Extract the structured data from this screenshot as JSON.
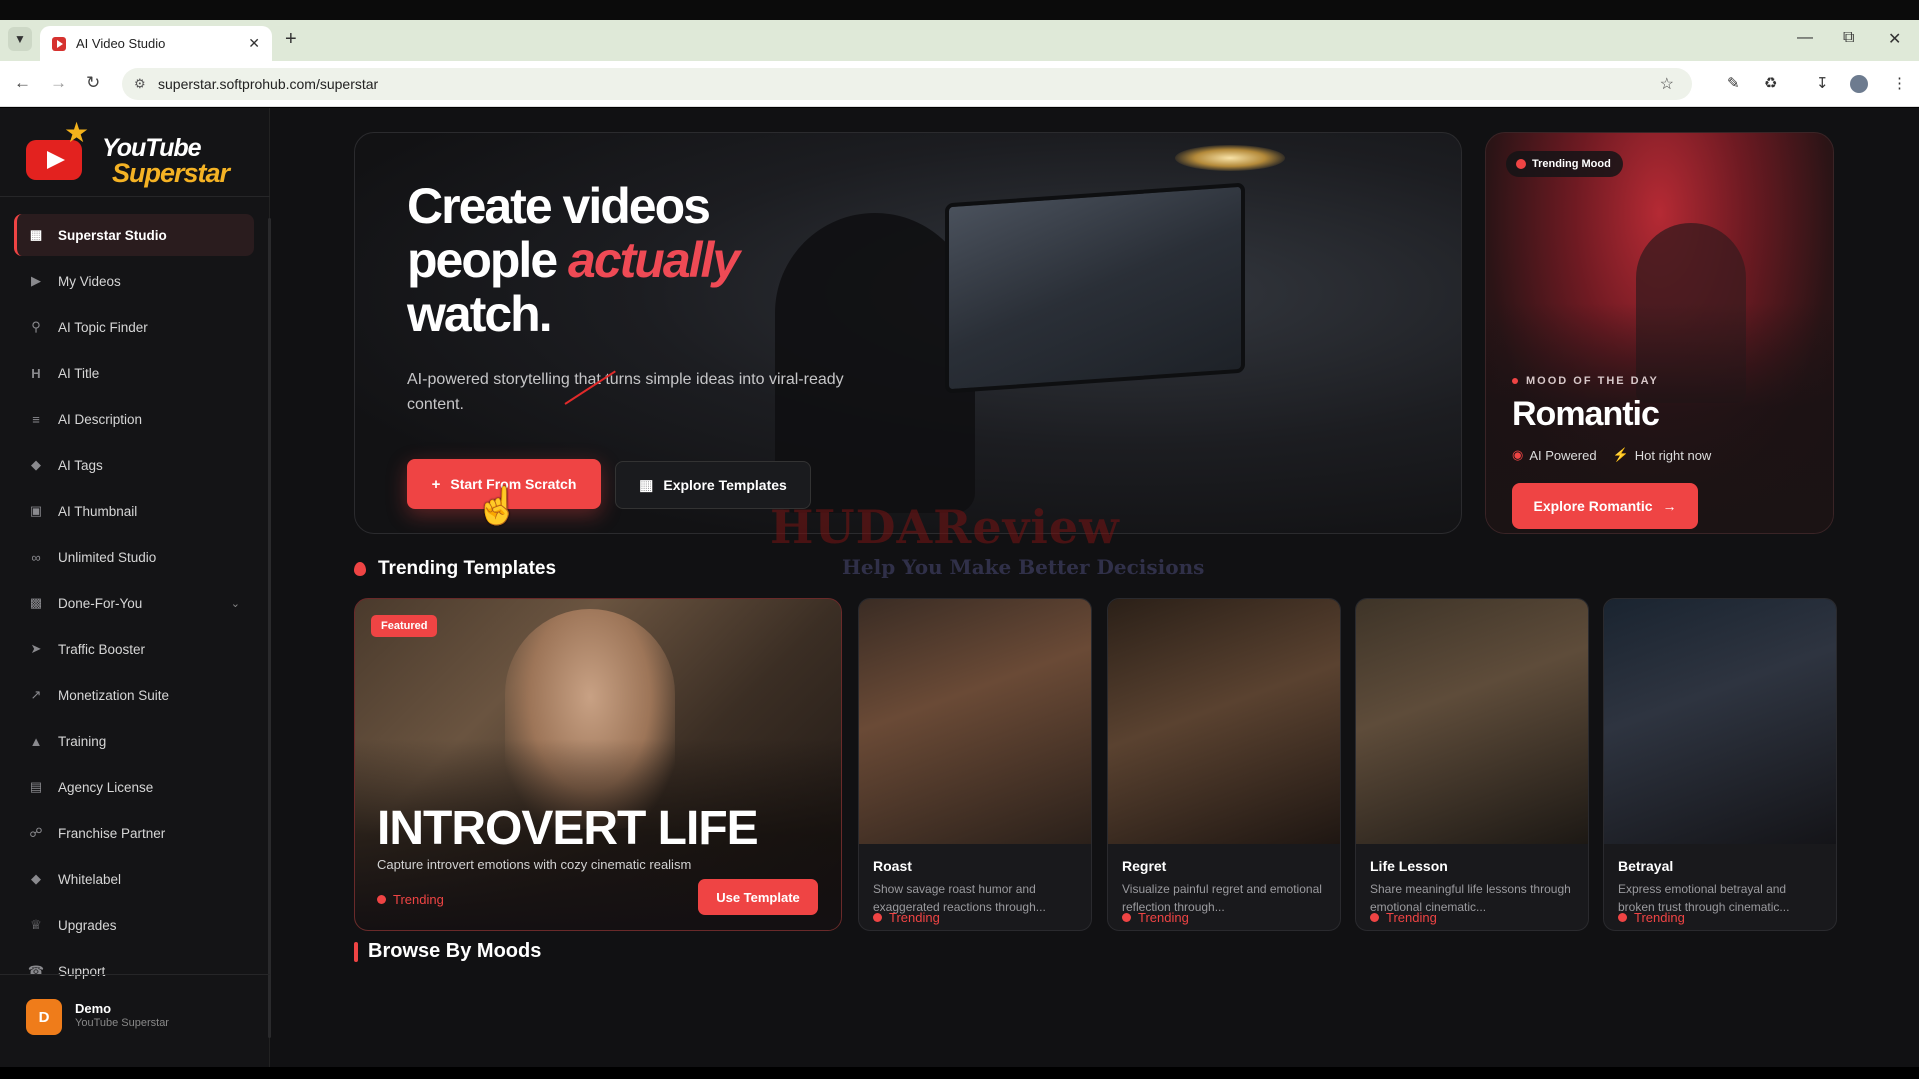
{
  "browser": {
    "tab_title": "AI Video Studio",
    "url": "superstar.softprohub.com/superstar"
  },
  "logo": {
    "word1": "YouTube",
    "word2": "Superstar"
  },
  "sidebar": {
    "items": [
      {
        "label": "Superstar Studio",
        "icon": "grid-icon"
      },
      {
        "label": "My Videos",
        "icon": "play-circle-icon"
      },
      {
        "label": "AI Topic Finder",
        "icon": "search-icon"
      },
      {
        "label": "AI Title",
        "icon": "heading-icon"
      },
      {
        "label": "AI Description",
        "icon": "align-left-icon"
      },
      {
        "label": "AI Tags",
        "icon": "tag-icon"
      },
      {
        "label": "AI Thumbnail",
        "icon": "image-icon"
      },
      {
        "label": "Unlimited Studio",
        "icon": "infinity-icon"
      },
      {
        "label": "Done-For-You",
        "icon": "box-icon"
      },
      {
        "label": "Traffic Booster",
        "icon": "rocket-icon"
      },
      {
        "label": "Monetization Suite",
        "icon": "chart-line-icon"
      },
      {
        "label": "Training",
        "icon": "graduation-cap-icon"
      },
      {
        "label": "Agency License",
        "icon": "building-icon"
      },
      {
        "label": "Franchise Partner",
        "icon": "handshake-icon"
      },
      {
        "label": "Whitelabel",
        "icon": "tag-icon"
      },
      {
        "label": "Upgrades",
        "icon": "crown-icon"
      },
      {
        "label": "Support",
        "icon": "headset-icon"
      }
    ],
    "user": {
      "initial": "D",
      "name": "Demo",
      "subtitle": "YouTube Superstar"
    }
  },
  "hero": {
    "headline_line1": "Create videos",
    "headline_line2_a": "people ",
    "headline_accent": "actually",
    "headline_line3": "watch.",
    "subtitle": "AI-powered storytelling that turns simple ideas into viral-ready content.",
    "primary_button": "Start From Scratch",
    "secondary_button": "Explore Templates"
  },
  "mood_card": {
    "pill": "Trending Mood",
    "eyebrow": "MOOD OF THE DAY",
    "title": "Romantic",
    "meta1": "AI Powered",
    "meta2": "Hot right now",
    "button": "Explore Romantic"
  },
  "watermark": {
    "line1": "HUDAReview",
    "line2": "Help You Make Better Decisions"
  },
  "trending": {
    "title": "Trending Templates",
    "featured": {
      "badge": "Featured",
      "title": "INTROVERT LIFE",
      "description": "Capture introvert emotions with cozy cinematic realism",
      "trend_label": "Trending",
      "button": "Use Template"
    },
    "cards": [
      {
        "name": "Roast",
        "description": "Show savage roast humor and exaggerated reactions through...",
        "trend_label": "Trending"
      },
      {
        "name": "Regret",
        "description": "Visualize painful regret and emotional reflection through...",
        "trend_label": "Trending"
      },
      {
        "name": "Life Lesson",
        "description": "Share meaningful life lessons through emotional cinematic...",
        "trend_label": "Trending"
      },
      {
        "name": "Betrayal",
        "description": "Express emotional betrayal and broken trust through cinematic...",
        "trend_label": "Trending"
      }
    ]
  },
  "browse": {
    "title": "Browse By Moods"
  },
  "colors": {
    "accent": "#ef4444",
    "background": "#111113",
    "sidebar": "#141416"
  }
}
